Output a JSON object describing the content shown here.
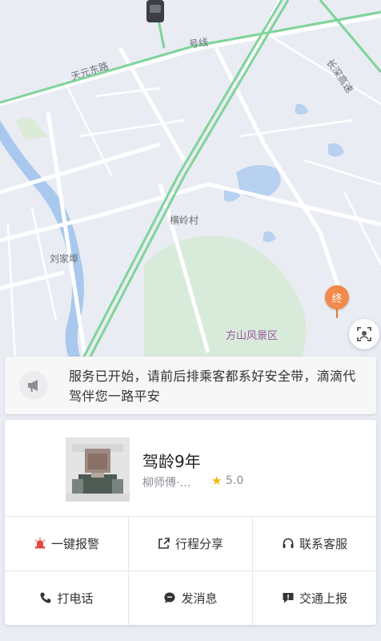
{
  "map": {
    "labels": {
      "road_tianyuan": "天元东路",
      "metro": "号线",
      "highway": "长深高速",
      "village": "横岭村",
      "liujiafu": "刘家埠",
      "scenic": "方山风景区"
    },
    "end_pin": "终"
  },
  "notice": {
    "text": "服务已开始，请前后排乘客都系好安全带，滴滴代驾伴您一路平安"
  },
  "driver": {
    "title": "驾龄9年",
    "name": "柳师傅·…",
    "rating": "5.0"
  },
  "actions": [
    {
      "label": "一键报警",
      "icon": "alarm-icon"
    },
    {
      "label": "行程分享",
      "icon": "share-icon"
    },
    {
      "label": "联系客服",
      "icon": "headset-icon"
    },
    {
      "label": "打电话",
      "icon": "phone-icon"
    },
    {
      "label": "发消息",
      "icon": "message-icon"
    },
    {
      "label": "交通上报",
      "icon": "report-icon"
    }
  ],
  "colors": {
    "map_bg": "#e9ecf3",
    "route_green": "#7fd49a",
    "end_pin": "#f28a4b",
    "alarm_red": "#e5483f"
  }
}
